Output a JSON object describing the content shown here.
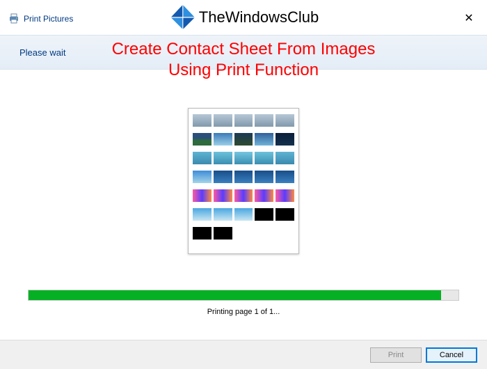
{
  "window": {
    "title": "Print Pictures",
    "close_label": "✕"
  },
  "overlay": {
    "site_name": "TheWindowsClub",
    "headline_line1": "Create Contact Sheet From Images",
    "headline_line2": "Using Print Function"
  },
  "band": {
    "wait_text": "Please wait"
  },
  "preview": {
    "thumbs": [
      {
        "bg": "linear-gradient(#b6c7d6,#8199ac)"
      },
      {
        "bg": "linear-gradient(#b6c7d6,#8199ac)"
      },
      {
        "bg": "linear-gradient(#b6c7d6,#8199ac)"
      },
      {
        "bg": "linear-gradient(#b6c7d6,#8199ac)"
      },
      {
        "bg": "linear-gradient(#b6c7d6,#8199ac)"
      },
      {
        "bg": "linear-gradient(180deg,#2a4f7a 40%,#2e6b3d 60%)"
      },
      {
        "bg": "linear-gradient(#3a7ab8,#9acfe8)"
      },
      {
        "bg": "linear-gradient(#1b3a55,#2e4a2f)"
      },
      {
        "bg": "linear-gradient(#30609a,#6fb3d9)"
      },
      {
        "bg": "linear-gradient(#0b1e3a,#12304d)"
      },
      {
        "bg": "linear-gradient(#5fb3d2,#3b8aaf)"
      },
      {
        "bg": "linear-gradient(#6cc1da,#3a8fb2)"
      },
      {
        "bg": "linear-gradient(#74c6df,#3a8fb2)"
      },
      {
        "bg": "linear-gradient(#6cc1da,#3a8fb2)"
      },
      {
        "bg": "linear-gradient(#5fb3d2,#3b8aaf)"
      },
      {
        "bg": "linear-gradient(#3d8cd8,#a4d4e8)"
      },
      {
        "bg": "linear-gradient(#184e8a,#3b7fbf)"
      },
      {
        "bg": "linear-gradient(#184e8a,#3b7fbf)"
      },
      {
        "bg": "linear-gradient(#184e8a,#3b7fbf)"
      },
      {
        "bg": "linear-gradient(#184e8a,#3b7fbf)"
      },
      {
        "bg": "linear-gradient(90deg,#ff5aa0,#5a3cff,#ff8a3d)"
      },
      {
        "bg": "linear-gradient(90deg,#ff5aa0,#5a3cff,#ff8a3d)"
      },
      {
        "bg": "linear-gradient(90deg,#ff5aa0,#5a3cff,#ff8a3d)"
      },
      {
        "bg": "linear-gradient(90deg,#ff5aa0,#5a3cff,#ff8a3d)"
      },
      {
        "bg": "linear-gradient(90deg,#ff5aa0,#5a3cff,#ff8a3d)"
      },
      {
        "bg": "linear-gradient(#4aa7e0,#c8e6f2)"
      },
      {
        "bg": "linear-gradient(#4aa7e0,#c8e6f2)"
      },
      {
        "bg": "linear-gradient(#4aa7e0,#c8e6f2)"
      },
      {
        "bg": "#000"
      },
      {
        "bg": "#000"
      },
      {
        "bg": "#000"
      },
      {
        "bg": "#000"
      },
      {
        "bg": "",
        "empty": true
      },
      {
        "bg": "",
        "empty": true
      },
      {
        "bg": "",
        "empty": true
      }
    ]
  },
  "progress": {
    "percent": 96,
    "status_text": "Printing page 1 of 1..."
  },
  "footer": {
    "print_label": "Print",
    "cancel_label": "Cancel",
    "print_disabled": true
  }
}
